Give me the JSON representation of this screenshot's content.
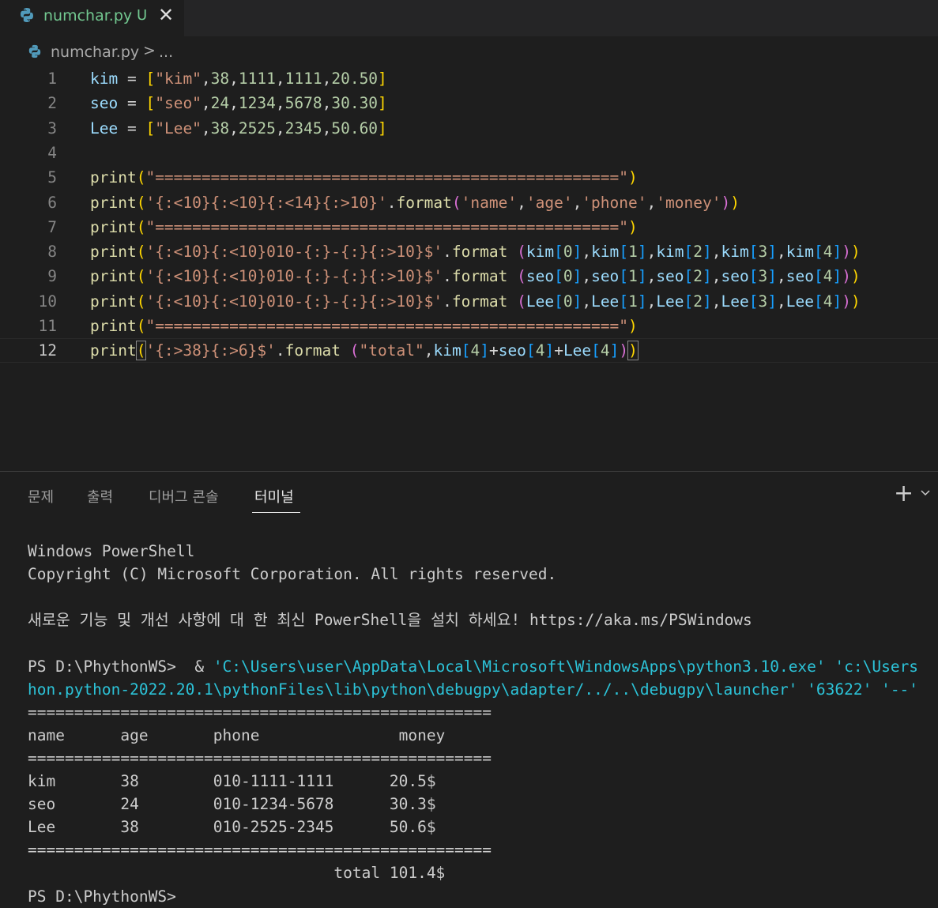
{
  "tab": {
    "filename": "numchar.py",
    "status": "U",
    "close": "✕"
  },
  "breadcrumb": {
    "file": "numchar.py",
    "separator": ">",
    "rest": "..."
  },
  "editor": {
    "line_numbers": [
      "1",
      "2",
      "3",
      "4",
      "5",
      "6",
      "7",
      "8",
      "9",
      "10",
      "11",
      "12"
    ],
    "lines": [
      [
        [
          "v",
          "kim"
        ],
        [
          "p",
          " = "
        ],
        [
          "b1",
          "["
        ],
        [
          "s",
          "\"kim\""
        ],
        [
          "p",
          ","
        ],
        [
          "n",
          "38"
        ],
        [
          "p",
          ","
        ],
        [
          "n",
          "1111"
        ],
        [
          "p",
          ","
        ],
        [
          "n",
          "1111"
        ],
        [
          "p",
          ","
        ],
        [
          "n",
          "20.50"
        ],
        [
          "b1",
          "]"
        ]
      ],
      [
        [
          "v",
          "seo"
        ],
        [
          "p",
          " = "
        ],
        [
          "b1",
          "["
        ],
        [
          "s",
          "\"seo\""
        ],
        [
          "p",
          ","
        ],
        [
          "n",
          "24"
        ],
        [
          "p",
          ","
        ],
        [
          "n",
          "1234"
        ],
        [
          "p",
          ","
        ],
        [
          "n",
          "5678"
        ],
        [
          "p",
          ","
        ],
        [
          "n",
          "30.30"
        ],
        [
          "b1",
          "]"
        ]
      ],
      [
        [
          "v",
          "Lee"
        ],
        [
          "p",
          " = "
        ],
        [
          "b1",
          "["
        ],
        [
          "s",
          "\"Lee\""
        ],
        [
          "p",
          ","
        ],
        [
          "n",
          "38"
        ],
        [
          "p",
          ","
        ],
        [
          "n",
          "2525"
        ],
        [
          "p",
          ","
        ],
        [
          "n",
          "2345"
        ],
        [
          "p",
          ","
        ],
        [
          "n",
          "50.60"
        ],
        [
          "b1",
          "]"
        ]
      ],
      [],
      [
        [
          "f",
          "print"
        ],
        [
          "b1",
          "("
        ],
        [
          "s",
          "\"==================================================\""
        ],
        [
          "b1",
          ")"
        ]
      ],
      [
        [
          "f",
          "print"
        ],
        [
          "b1",
          "("
        ],
        [
          "s",
          "'{:<10}{:<10}{:<14}{:>10}'"
        ],
        [
          "p",
          "."
        ],
        [
          "f",
          "format"
        ],
        [
          "b2",
          "("
        ],
        [
          "s",
          "'name'"
        ],
        [
          "p",
          ","
        ],
        [
          "s",
          "'age'"
        ],
        [
          "p",
          ","
        ],
        [
          "s",
          "'phone'"
        ],
        [
          "p",
          ","
        ],
        [
          "s",
          "'money'"
        ],
        [
          "b2",
          ")"
        ],
        [
          "b1",
          ")"
        ]
      ],
      [
        [
          "f",
          "print"
        ],
        [
          "b1",
          "("
        ],
        [
          "s",
          "\"==================================================\""
        ],
        [
          "b1",
          ")"
        ]
      ],
      [
        [
          "f",
          "print"
        ],
        [
          "b1",
          "("
        ],
        [
          "s",
          "'{:<10}{:<10}010-{:}-{:}{:>10}$'"
        ],
        [
          "p",
          "."
        ],
        [
          "f",
          "format"
        ],
        [
          "p",
          " "
        ],
        [
          "b2",
          "("
        ],
        [
          "v",
          "kim"
        ],
        [
          "b3",
          "["
        ],
        [
          "n",
          "0"
        ],
        [
          "b3",
          "]"
        ],
        [
          "p",
          ","
        ],
        [
          "v",
          "kim"
        ],
        [
          "b3",
          "["
        ],
        [
          "n",
          "1"
        ],
        [
          "b3",
          "]"
        ],
        [
          "p",
          ","
        ],
        [
          "v",
          "kim"
        ],
        [
          "b3",
          "["
        ],
        [
          "n",
          "2"
        ],
        [
          "b3",
          "]"
        ],
        [
          "p",
          ","
        ],
        [
          "v",
          "kim"
        ],
        [
          "b3",
          "["
        ],
        [
          "n",
          "3"
        ],
        [
          "b3",
          "]"
        ],
        [
          "p",
          ","
        ],
        [
          "v",
          "kim"
        ],
        [
          "b3",
          "["
        ],
        [
          "n",
          "4"
        ],
        [
          "b3",
          "]"
        ],
        [
          "b2",
          ")"
        ],
        [
          "b1",
          ")"
        ]
      ],
      [
        [
          "f",
          "print"
        ],
        [
          "b1",
          "("
        ],
        [
          "s",
          "'{:<10}{:<10}010-{:}-{:}{:>10}$'"
        ],
        [
          "p",
          "."
        ],
        [
          "f",
          "format"
        ],
        [
          "p",
          " "
        ],
        [
          "b2",
          "("
        ],
        [
          "v",
          "seo"
        ],
        [
          "b3",
          "["
        ],
        [
          "n",
          "0"
        ],
        [
          "b3",
          "]"
        ],
        [
          "p",
          ","
        ],
        [
          "v",
          "seo"
        ],
        [
          "b3",
          "["
        ],
        [
          "n",
          "1"
        ],
        [
          "b3",
          "]"
        ],
        [
          "p",
          ","
        ],
        [
          "v",
          "seo"
        ],
        [
          "b3",
          "["
        ],
        [
          "n",
          "2"
        ],
        [
          "b3",
          "]"
        ],
        [
          "p",
          ","
        ],
        [
          "v",
          "seo"
        ],
        [
          "b3",
          "["
        ],
        [
          "n",
          "3"
        ],
        [
          "b3",
          "]"
        ],
        [
          "p",
          ","
        ],
        [
          "v",
          "seo"
        ],
        [
          "b3",
          "["
        ],
        [
          "n",
          "4"
        ],
        [
          "b3",
          "]"
        ],
        [
          "b2",
          ")"
        ],
        [
          "b1",
          ")"
        ]
      ],
      [
        [
          "f",
          "print"
        ],
        [
          "b1",
          "("
        ],
        [
          "s",
          "'{:<10}{:<10}010-{:}-{:}{:>10}$'"
        ],
        [
          "p",
          "."
        ],
        [
          "f",
          "format"
        ],
        [
          "p",
          " "
        ],
        [
          "b2",
          "("
        ],
        [
          "v",
          "Lee"
        ],
        [
          "b3",
          "["
        ],
        [
          "n",
          "0"
        ],
        [
          "b3",
          "]"
        ],
        [
          "p",
          ","
        ],
        [
          "v",
          "Lee"
        ],
        [
          "b3",
          "["
        ],
        [
          "n",
          "1"
        ],
        [
          "b3",
          "]"
        ],
        [
          "p",
          ","
        ],
        [
          "v",
          "Lee"
        ],
        [
          "b3",
          "["
        ],
        [
          "n",
          "2"
        ],
        [
          "b3",
          "]"
        ],
        [
          "p",
          ","
        ],
        [
          "v",
          "Lee"
        ],
        [
          "b3",
          "["
        ],
        [
          "n",
          "3"
        ],
        [
          "b3",
          "]"
        ],
        [
          "p",
          ","
        ],
        [
          "v",
          "Lee"
        ],
        [
          "b3",
          "["
        ],
        [
          "n",
          "4"
        ],
        [
          "b3",
          "]"
        ],
        [
          "b2",
          ")"
        ],
        [
          "b1",
          ")"
        ]
      ],
      [
        [
          "f",
          "print"
        ],
        [
          "b1",
          "("
        ],
        [
          "s",
          "\"==================================================\""
        ],
        [
          "b1",
          ")"
        ]
      ],
      [
        [
          "f",
          "print"
        ],
        [
          "b1c",
          "("
        ],
        [
          "s",
          "'{:>38}{:>6}$'"
        ],
        [
          "p",
          "."
        ],
        [
          "f",
          "format"
        ],
        [
          "p",
          " "
        ],
        [
          "b2",
          "("
        ],
        [
          "s",
          "\"total\""
        ],
        [
          "p",
          ","
        ],
        [
          "v",
          "kim"
        ],
        [
          "b3",
          "["
        ],
        [
          "n",
          "4"
        ],
        [
          "b3",
          "]"
        ],
        [
          "p",
          "+"
        ],
        [
          "v",
          "seo"
        ],
        [
          "b3",
          "["
        ],
        [
          "n",
          "4"
        ],
        [
          "b3",
          "]"
        ],
        [
          "p",
          "+"
        ],
        [
          "v",
          "Lee"
        ],
        [
          "b3",
          "["
        ],
        [
          "n",
          "4"
        ],
        [
          "b3",
          "]"
        ],
        [
          "b2",
          ")"
        ],
        [
          "b1c",
          ")"
        ]
      ]
    ]
  },
  "panel": {
    "tabs": [
      "문제",
      "출력",
      "디버그 콘솔",
      "터미널"
    ],
    "active_tab": "터미널",
    "plus": "+",
    "chevron": "⌄"
  },
  "terminal": {
    "lines": [
      {
        "row": 0,
        "text": "Windows PowerShell"
      },
      {
        "row": 1,
        "text": "Copyright (C) Microsoft Corporation. All rights reserved."
      },
      {
        "row": 3,
        "text": "새로운 기능 및 개선 사항에 대 한 최신 PowerShell을 설치 하세요! https://aka.ms/PSWindows"
      },
      {
        "row": 5,
        "prompt": "PS D:\\PhythonWS>  & ",
        "cmd": "'C:\\Users\\user\\AppData\\Local\\Microsoft\\WindowsApps\\python3.10.exe' 'c:\\Users"
      },
      {
        "row": 6,
        "cmd": "hon.python-2022.20.1\\pythonFiles\\lib\\python\\debugpy\\adapter/../..\\debugpy\\launcher' '63622' '--'"
      },
      {
        "row": 7,
        "text": "=================================================="
      },
      {
        "row": 8,
        "text": "name      age       phone               money"
      },
      {
        "row": 9,
        "text": "=================================================="
      },
      {
        "row": 10,
        "text": "kim       38        010-1111-1111      20.5$"
      },
      {
        "row": 11,
        "text": "seo       24        010-1234-5678      30.3$"
      },
      {
        "row": 12,
        "text": "Lee       38        010-2525-2345      50.6$"
      },
      {
        "row": 13,
        "text": "=================================================="
      },
      {
        "row": 14,
        "text": "                                 total 101.4$"
      },
      {
        "row": 15,
        "text": "PS D:\\PhythonWS>"
      }
    ]
  }
}
